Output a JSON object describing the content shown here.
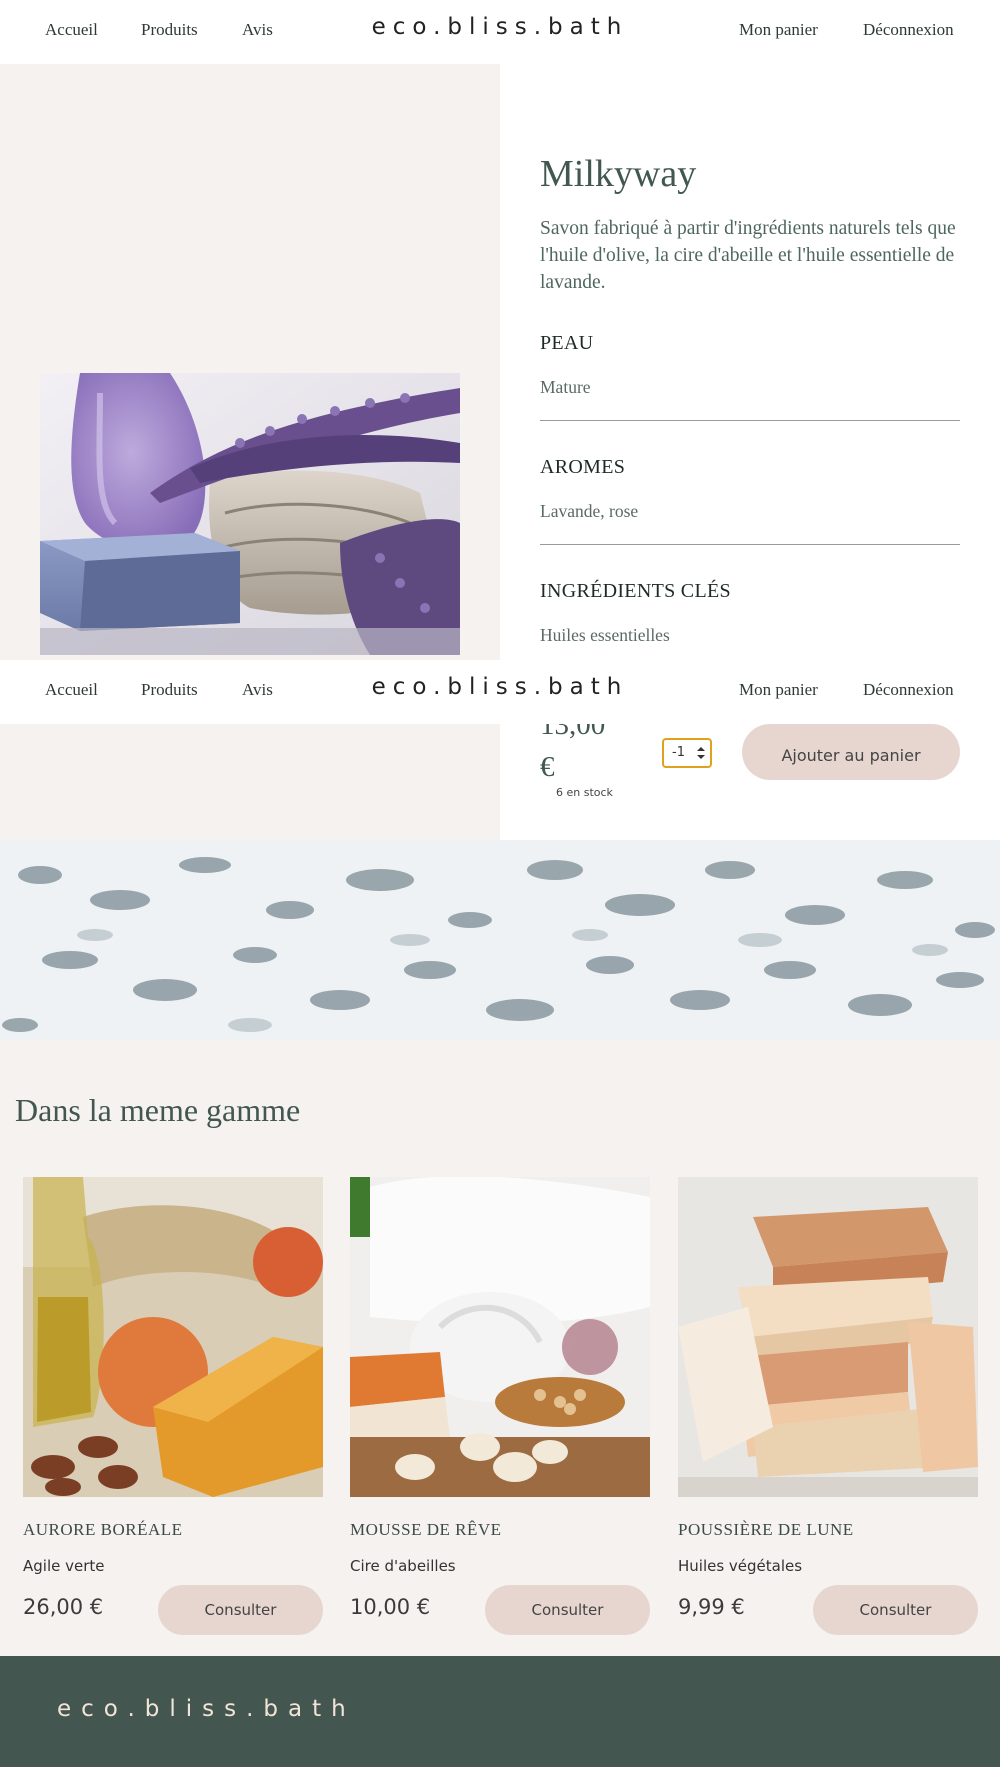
{
  "nav": {
    "links": [
      "Accueil",
      "Produits",
      "Avis"
    ],
    "logo": "eco.bliss.bath",
    "cart": "Mon panier",
    "logout": "Déconnexion"
  },
  "product": {
    "title": "Milkyway",
    "description": "Savon fabriqué à partir d'ingrédients naturels tels que l'huile d'olive, la cire d'abeille et l'huile essentielle de lavande.",
    "skin_label": "PEAU",
    "skin_value": "Mature",
    "aroma_label": "AROMES",
    "aroma_value": "Lavande, rose",
    "ingredients_label": "INGRÉDIENTS CLÉS",
    "ingredients_value": "Huiles essentielles",
    "price": "13,00 €",
    "stock": "6 en stock",
    "quantity": "-1",
    "add_button": "Ajouter au panier",
    "image_icon": "lavender-soap-photo"
  },
  "range": {
    "title": "Dans la meme gamme",
    "cards": [
      {
        "name": "AURORE BORÉALE",
        "subtitle": "Agile verte",
        "price": "26,00 €",
        "button": "Consulter",
        "image_icon": "orange-soap-photo"
      },
      {
        "name": "MOUSSE DE RÊVE",
        "subtitle": "Cire d'abeilles",
        "price": "10,00 €",
        "button": "Consulter",
        "image_icon": "towels-soap-photo"
      },
      {
        "name": "POUSSIÈRE DE LUNE",
        "subtitle": "Huiles végétales",
        "price": "9,99 €",
        "button": "Consulter",
        "image_icon": "stacked-soaps-photo"
      }
    ]
  },
  "footer": {
    "logo": "eco.bliss.bath"
  },
  "colors": {
    "beige_bg": "#f6f2ef",
    "accent_button": "#e7d6cf",
    "green_text": "#41574f",
    "footer_bg": "#435750",
    "focus_outline": "#e0a21c"
  }
}
